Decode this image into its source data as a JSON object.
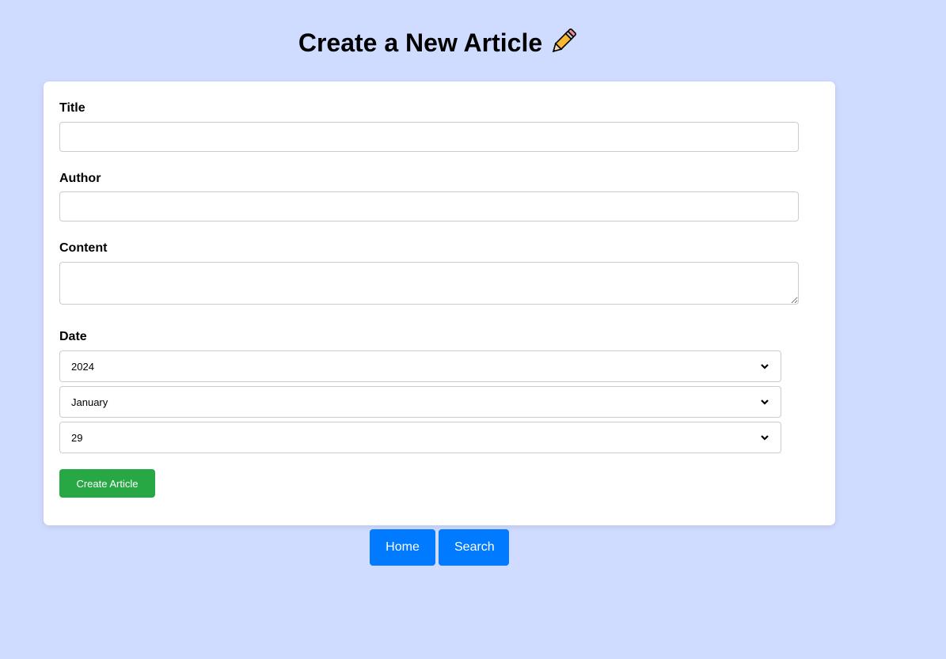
{
  "page": {
    "title": "Create a New Article",
    "title_icon": "pencil-icon"
  },
  "form": {
    "title_label": "Title",
    "title_value": "",
    "author_label": "Author",
    "author_value": "",
    "content_label": "Content",
    "content_value": "",
    "date_label": "Date",
    "year_selected": "2024",
    "month_selected": "January",
    "day_selected": "29",
    "submit_label": "Create Article"
  },
  "nav": {
    "home_label": "Home",
    "search_label": "Search"
  },
  "colors": {
    "background": "#d0dcff",
    "submit": "#28a745",
    "nav_button": "#007bff"
  }
}
